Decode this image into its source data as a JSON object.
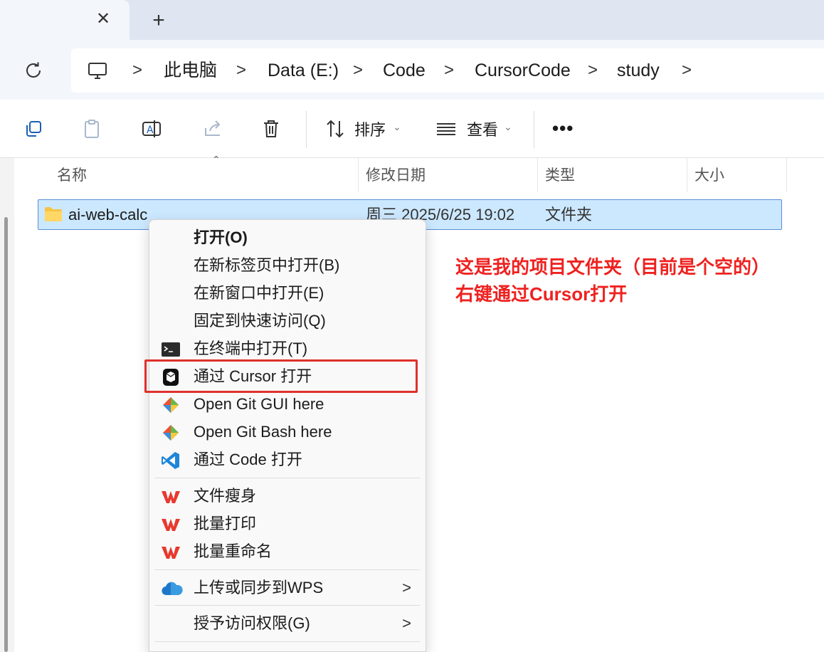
{
  "window": {
    "tab_close_glyph": "✕",
    "tab_new_glyph": "+"
  },
  "address": {
    "separator": ">",
    "crumbs": [
      "此电脑",
      "Data (E:)",
      "Code",
      "CursorCode",
      "study"
    ]
  },
  "toolbar": {
    "sort_label": "排序",
    "view_label": "查看",
    "more_label": "•••"
  },
  "columns": {
    "name": "名称",
    "modified": "修改日期",
    "type": "类型",
    "size": "大小"
  },
  "files": [
    {
      "name": "ai-web-calc",
      "modified": "周三 2025/6/25 19:02",
      "type": "文件夹",
      "selected": true
    }
  ],
  "context_menu": {
    "items": [
      {
        "label": "打开(O)",
        "icon": "none",
        "bold": true
      },
      {
        "label": "在新标签页中打开(B)",
        "icon": "none"
      },
      {
        "label": "在新窗口中打开(E)",
        "icon": "none"
      },
      {
        "label": "固定到快速访问(Q)",
        "icon": "none"
      },
      {
        "label": "在终端中打开(T)",
        "icon": "terminal-icon"
      },
      {
        "label": "通过 Cursor 打开",
        "icon": "cursor-icon",
        "highlighted": true
      },
      {
        "label": "Open Git GUI here",
        "icon": "git-gui-icon"
      },
      {
        "label": "Open Git Bash here",
        "icon": "git-bash-icon"
      },
      {
        "label": "通过 Code 打开",
        "icon": "vscode-icon"
      },
      {
        "label": "文件瘦身",
        "icon": "wps-icon"
      },
      {
        "label": "批量打印",
        "icon": "wps-icon"
      },
      {
        "label": "批量重命名",
        "icon": "wps-icon"
      },
      {
        "label": "上传或同步到WPS",
        "icon": "cloud-icon",
        "submenu": true
      },
      {
        "label": "授予访问权限(G)",
        "icon": "none",
        "submenu": true
      }
    ],
    "submenu_glyph": ">"
  },
  "annotation": {
    "line1": "这是我的项目文件夹（目前是个空的）",
    "line2": "右键通过Cursor打开"
  },
  "colors": {
    "highlight_box": "#e0302b",
    "annotation_text": "#ee2220",
    "selection_fill": "#cce8ff",
    "selection_border": "#5a8fd6"
  }
}
